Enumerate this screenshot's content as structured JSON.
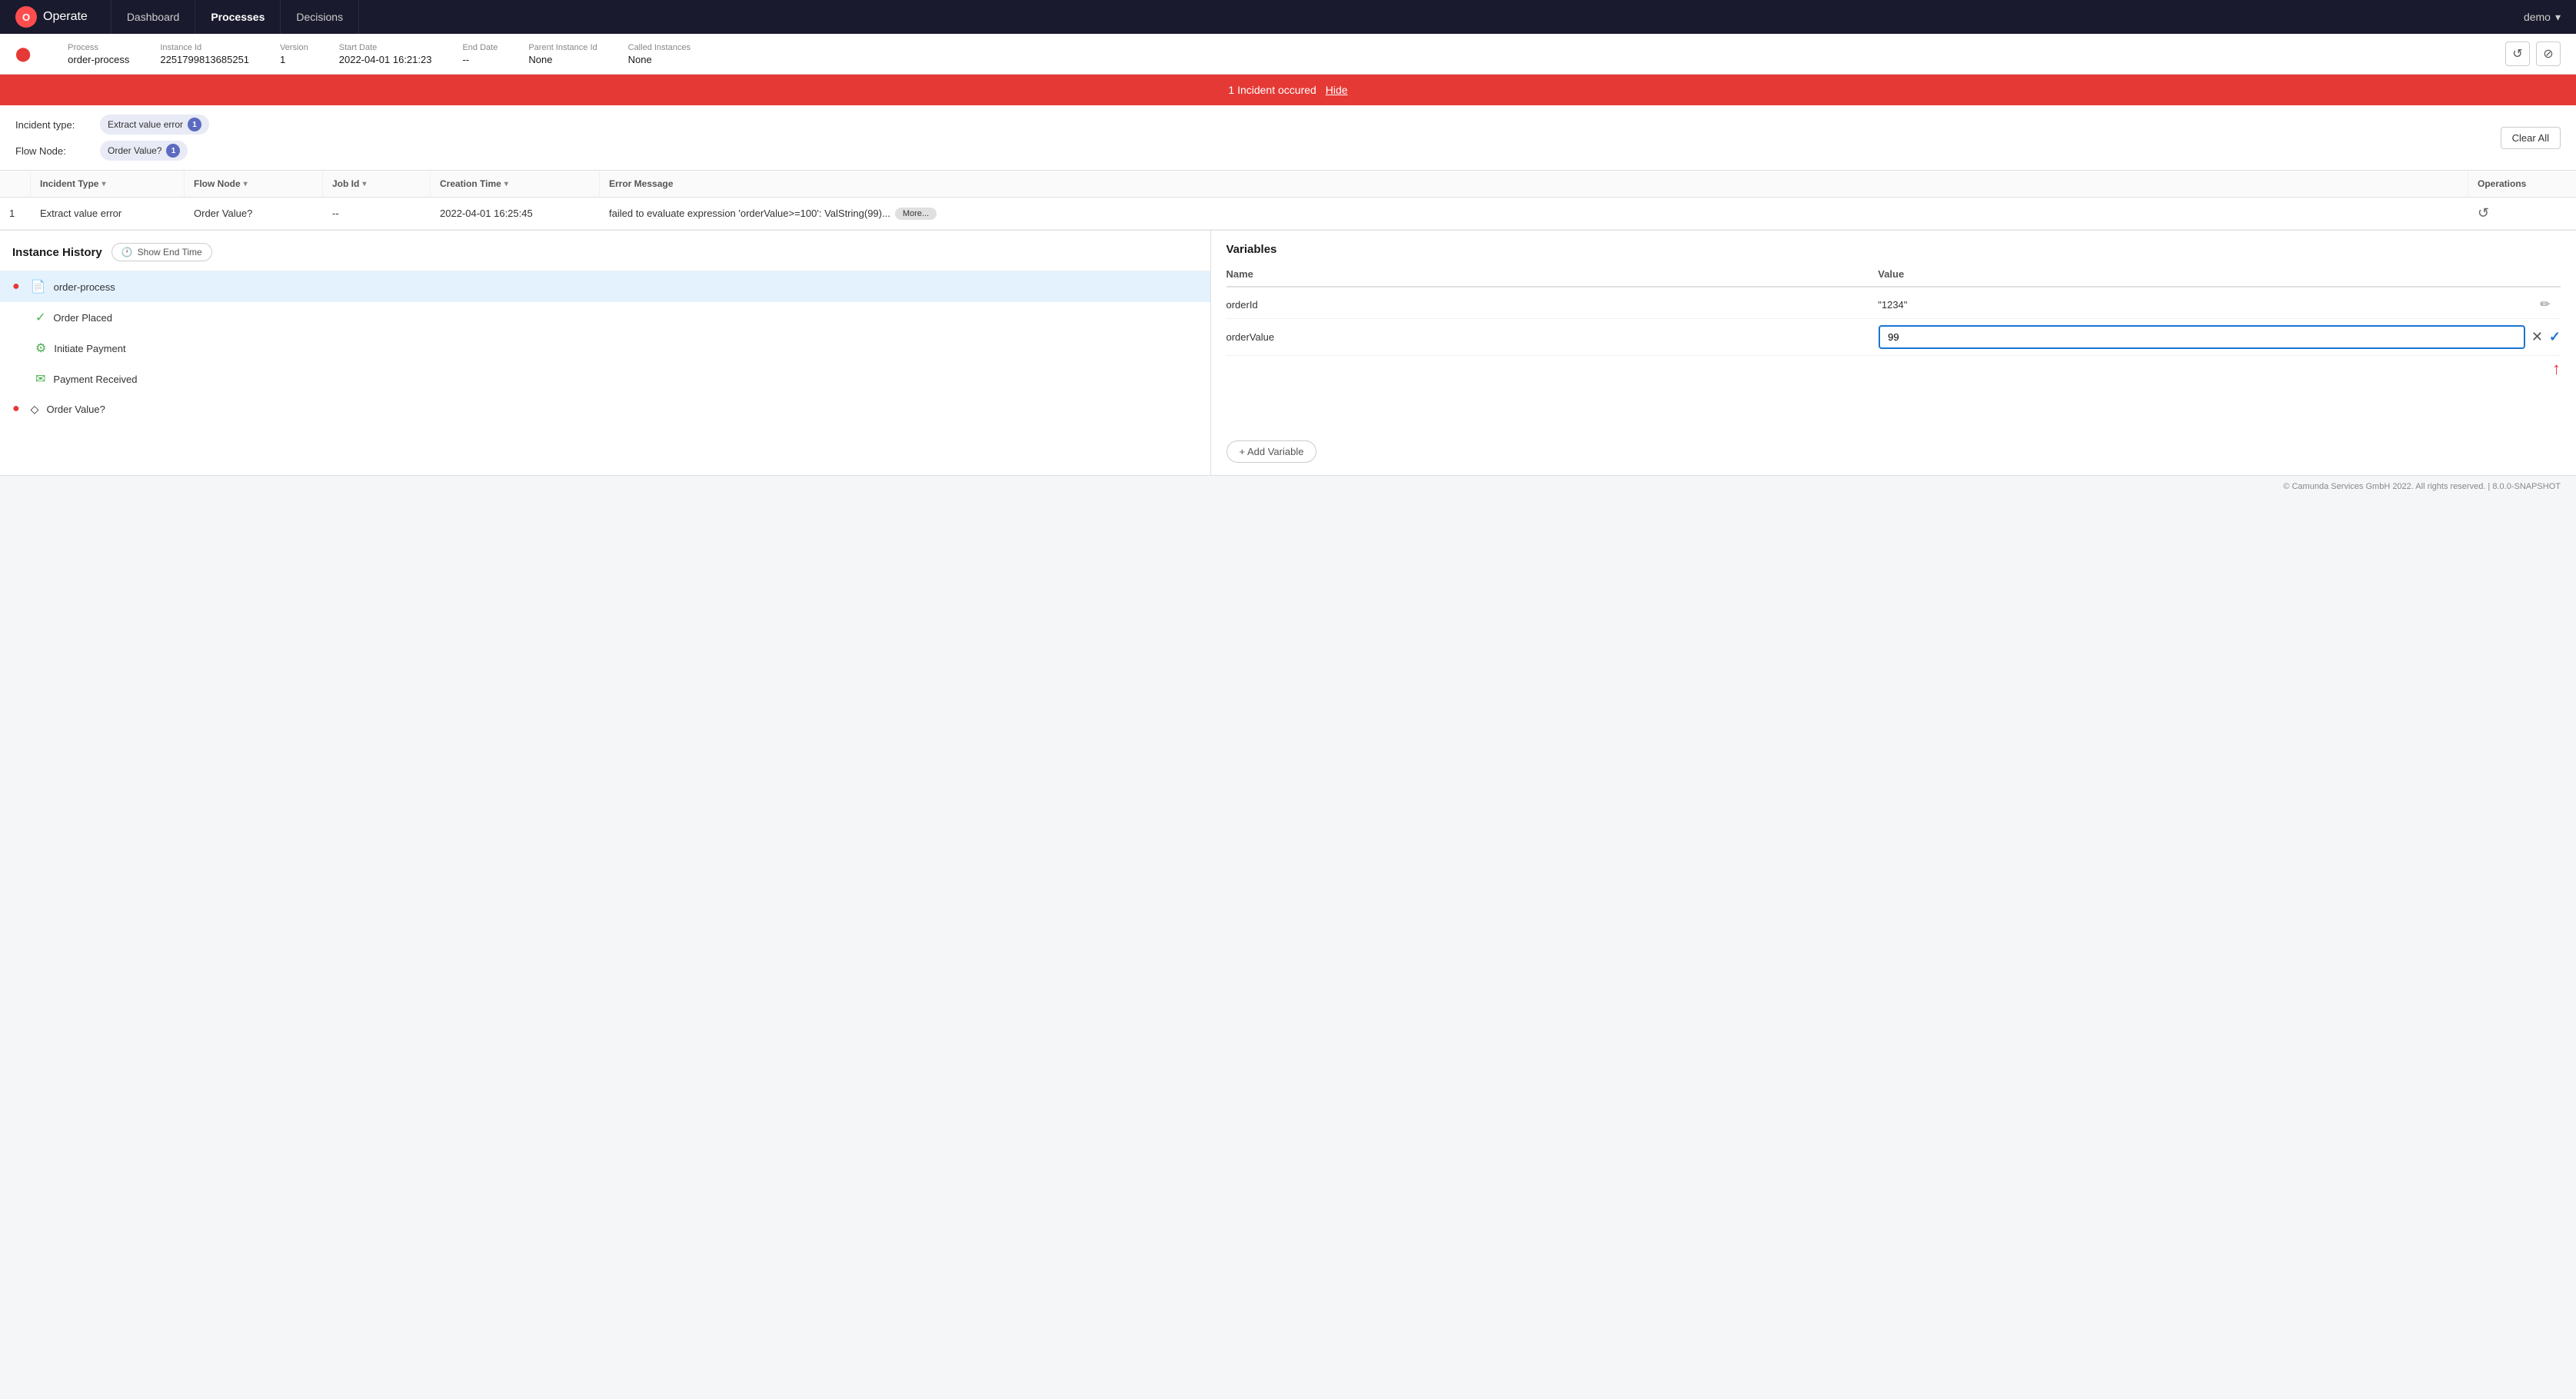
{
  "nav": {
    "logo_text": "O",
    "app_name": "Operate",
    "items": [
      {
        "label": "Dashboard",
        "active": false
      },
      {
        "label": "Processes",
        "active": true
      },
      {
        "label": "Decisions",
        "active": false
      }
    ],
    "user": "demo"
  },
  "process_header": {
    "process_label": "Process",
    "process_value": "order-process",
    "instance_id_label": "Instance Id",
    "instance_id_value": "2251799813685251",
    "version_label": "Version",
    "version_value": "1",
    "start_date_label": "Start Date",
    "start_date_value": "2022-04-01 16:21:23",
    "end_date_label": "End Date",
    "end_date_value": "--",
    "parent_label": "Parent Instance Id",
    "parent_value": "None",
    "called_label": "Called Instances",
    "called_value": "None"
  },
  "incident_banner": {
    "text": "1 Incident occured",
    "hide_link": "Hide"
  },
  "filters": {
    "incident_type_label": "Incident type:",
    "incident_type_value": "Extract value error",
    "incident_type_count": "1",
    "flow_node_label": "Flow Node:",
    "flow_node_value": "Order Value?",
    "flow_node_count": "1",
    "clear_all": "Clear All"
  },
  "table": {
    "columns": [
      {
        "label": "",
        "key": "num"
      },
      {
        "label": "Incident Type",
        "key": "type",
        "sortable": true
      },
      {
        "label": "Flow Node",
        "key": "node",
        "sortable": true
      },
      {
        "label": "Job Id",
        "key": "job_id",
        "sortable": true
      },
      {
        "label": "Creation Time",
        "key": "time",
        "sortable": true
      },
      {
        "label": "Error Message",
        "key": "message"
      },
      {
        "label": "Operations",
        "key": "ops"
      }
    ],
    "rows": [
      {
        "num": "1",
        "type": "Extract value error",
        "node": "Order Value?",
        "job_id": "--",
        "time": "2022-04-01 16:25:45",
        "message": "failed to evaluate expression 'orderValue>=100': ValString(99)...",
        "more_label": "More..."
      }
    ]
  },
  "instance_history": {
    "title": "Instance History",
    "show_end_time": "Show End Time",
    "items": [
      {
        "name": "order-process",
        "icon": "document",
        "active": true,
        "error": true
      },
      {
        "name": "Order Placed",
        "icon": "circle",
        "active": false,
        "error": false,
        "completed": true
      },
      {
        "name": "Initiate Payment",
        "icon": "gear",
        "active": false,
        "error": false,
        "completed": true
      },
      {
        "name": "Payment Received",
        "icon": "message",
        "active": false,
        "error": false,
        "completed": true
      },
      {
        "name": "Order Value?",
        "icon": "diamond",
        "active": false,
        "error": true
      }
    ]
  },
  "variables": {
    "title": "Variables",
    "name_header": "Name",
    "value_header": "Value",
    "rows": [
      {
        "name": "orderId",
        "value": "\"1234\"",
        "editable": true
      },
      {
        "name": "orderValue",
        "value": "99",
        "editing": true
      }
    ],
    "add_variable": "+ Add Variable"
  },
  "footer": {
    "text": "© Camunda Services GmbH 2022. All rights reserved. | 8.0.0-SNAPSHOT"
  }
}
